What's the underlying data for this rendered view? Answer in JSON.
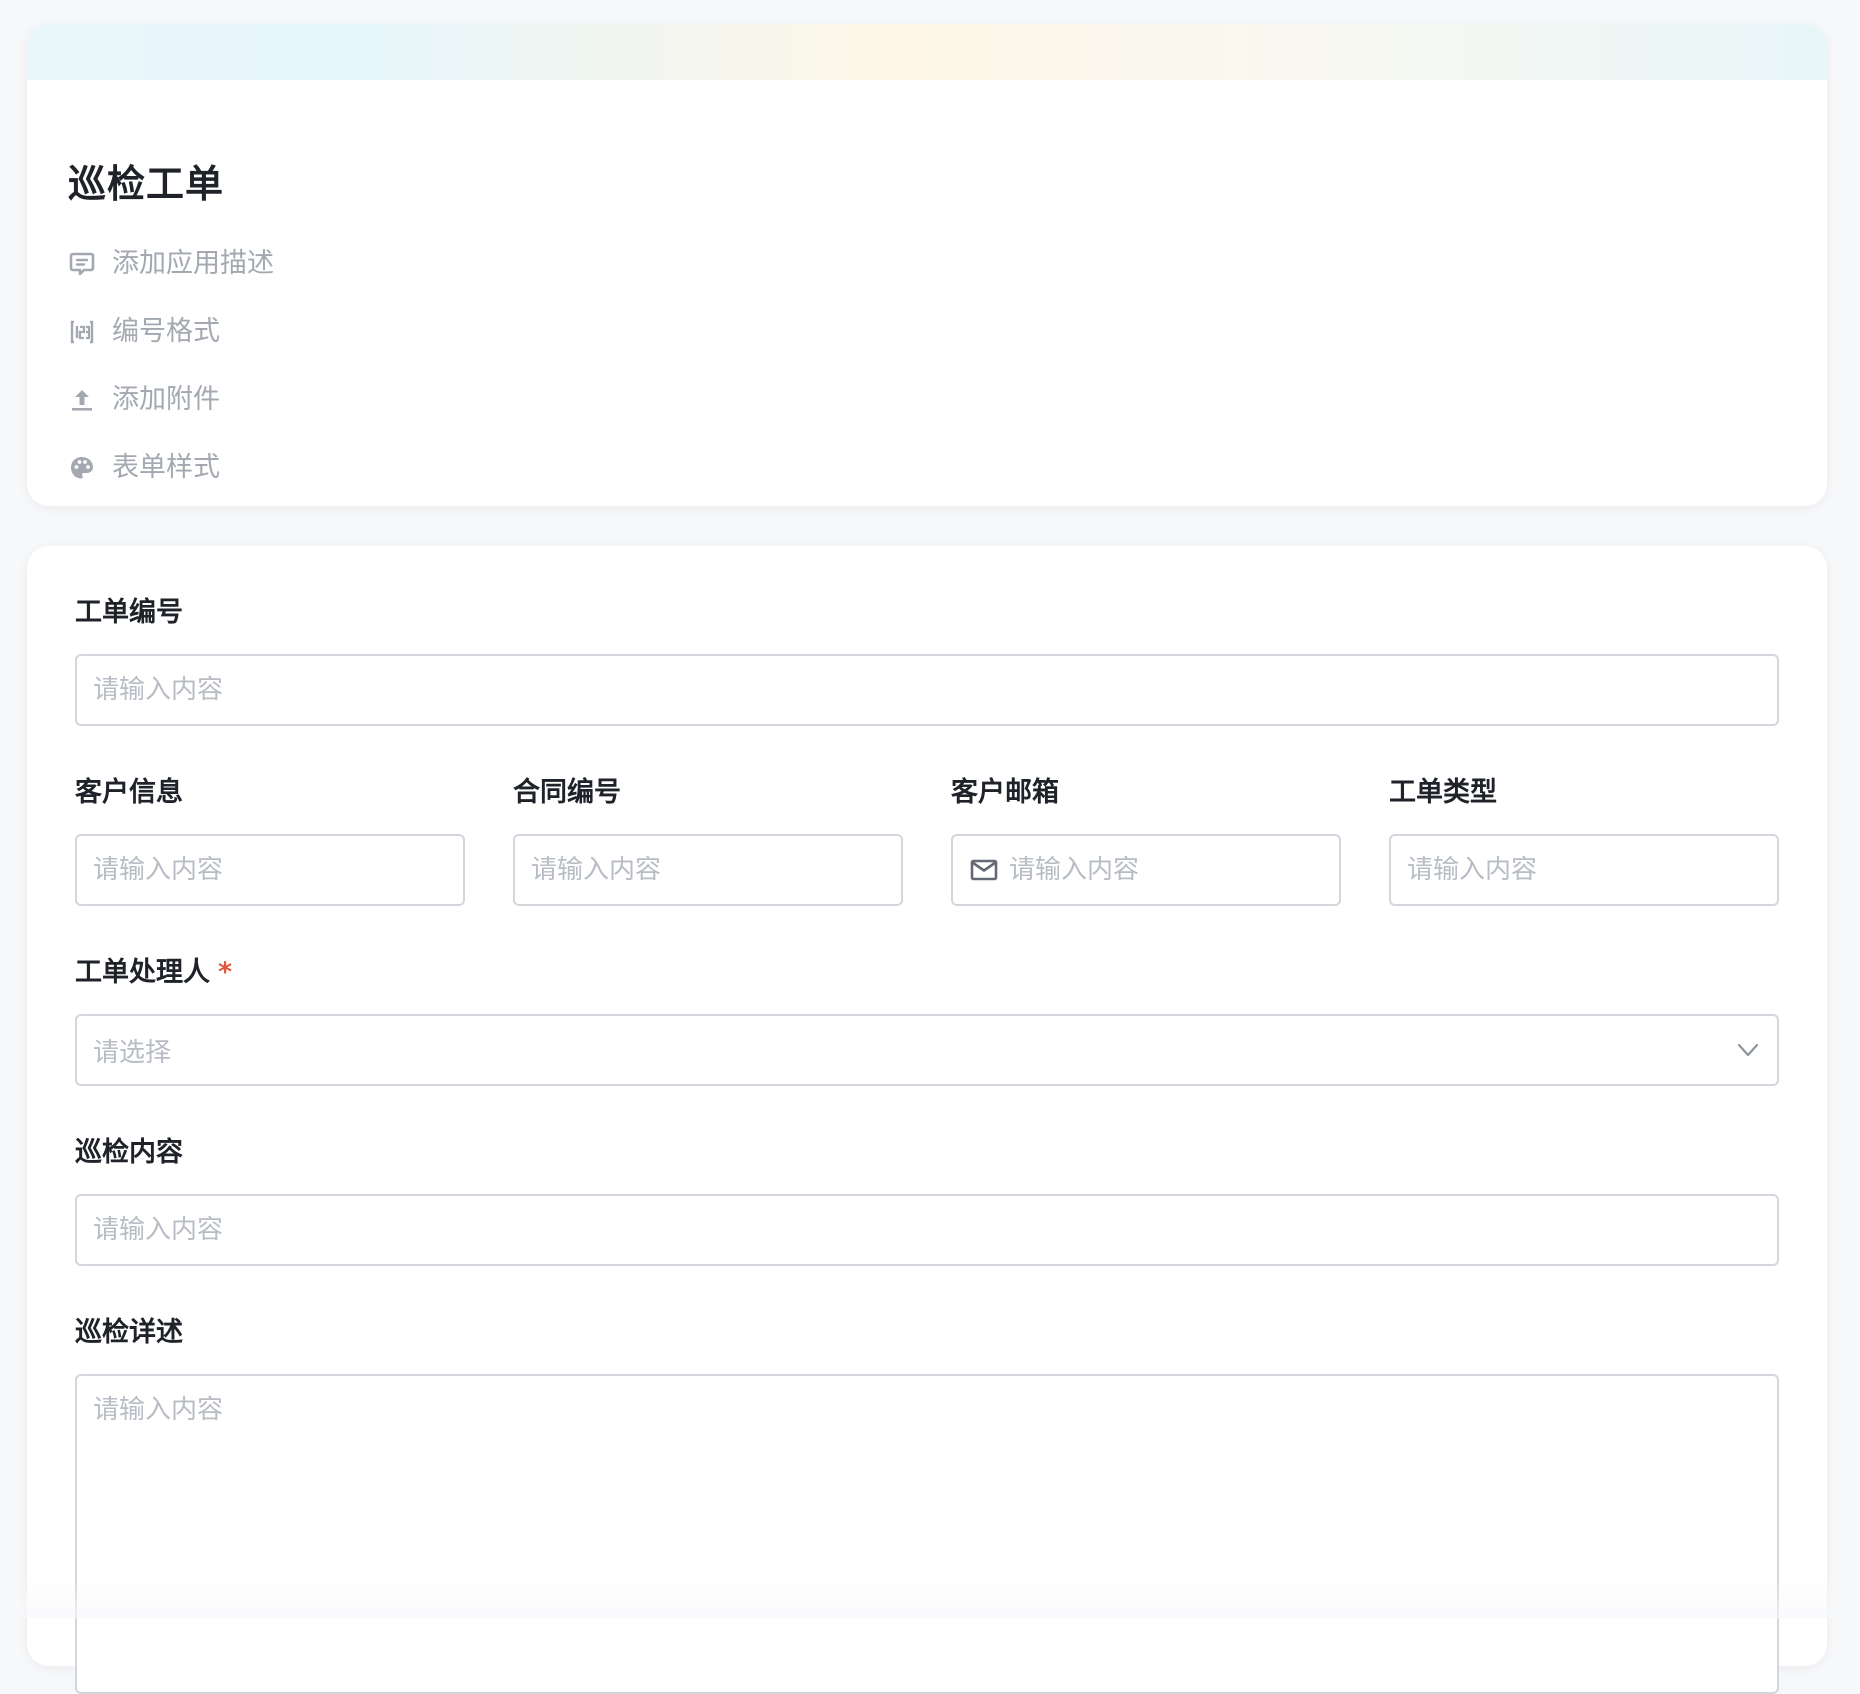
{
  "form": {
    "title": "巡检工单",
    "actions": [
      {
        "label": "添加应用描述",
        "icon": "comment-icon"
      },
      {
        "label": "编号格式",
        "icon": "number-format-icon"
      },
      {
        "label": "添加附件",
        "icon": "upload-icon"
      },
      {
        "label": "表单样式",
        "icon": "palette-icon"
      }
    ]
  },
  "fields": {
    "ticket_no": {
      "label": "工单编号",
      "placeholder": "请输入内容"
    },
    "customer_info": {
      "label": "客户信息",
      "placeholder": "请输入内容"
    },
    "contract_no": {
      "label": "合同编号",
      "placeholder": "请输入内容"
    },
    "customer_email": {
      "label": "客户邮箱",
      "placeholder": "请输入内容",
      "icon": "mail-icon"
    },
    "ticket_type": {
      "label": "工单类型",
      "placeholder": "请输入内容"
    },
    "handler": {
      "label": "工单处理人",
      "required_mark": "*",
      "placeholder": "请选择",
      "icon": "chevron-down-icon"
    },
    "inspection_content": {
      "label": "巡检内容",
      "placeholder": "请输入内容"
    },
    "inspection_details": {
      "label": "巡检详述",
      "placeholder": "请输入内容"
    }
  },
  "colors": {
    "background": "#f7f8fa",
    "label": "#1f2329",
    "placeholder": "#b8bcc4",
    "action_text": "#a3a8b1",
    "required": "#e0563f",
    "border": "#d3d6dc"
  }
}
